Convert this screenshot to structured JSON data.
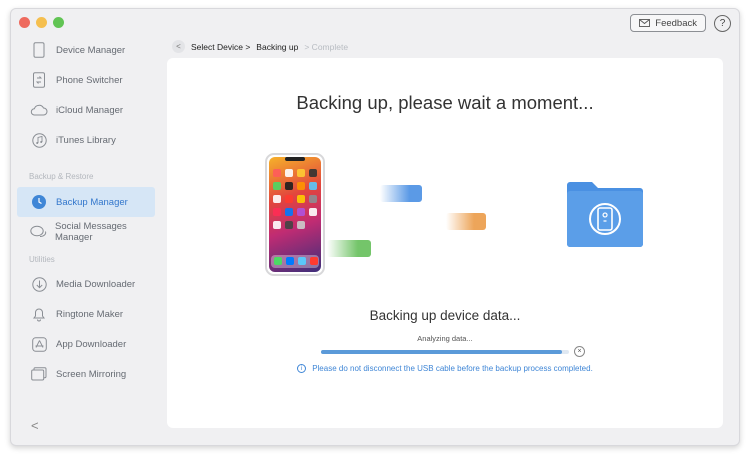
{
  "window": {
    "traffic_colors": [
      "#ee6a5e",
      "#f5bf4f",
      "#61c454"
    ]
  },
  "topbar": {
    "feedback_label": "Feedback",
    "help_label": "?"
  },
  "sidebar": {
    "items": [
      {
        "label": "Device Manager",
        "icon": "phone-outline-icon"
      },
      {
        "label": "Phone Switcher",
        "icon": "phone-transfer-icon"
      },
      {
        "label": "iCloud Manager",
        "icon": "cloud-icon"
      },
      {
        "label": "iTunes Library",
        "icon": "music-note-icon"
      },
      {
        "label": "Backup Manager",
        "icon": "backup-clock-icon",
        "active": true
      },
      {
        "label": "Social Messages Manager",
        "icon": "chat-bubbles-icon"
      },
      {
        "label": "Media Downloader",
        "icon": "download-circle-icon"
      },
      {
        "label": "Ringtone Maker",
        "icon": "bell-icon"
      },
      {
        "label": "App Downloader",
        "icon": "app-store-icon"
      },
      {
        "label": "Screen Mirroring",
        "icon": "screen-mirror-icon"
      }
    ],
    "sections": {
      "backup_restore": "Backup & Restore",
      "utilities": "Utilities"
    },
    "collapse_label": "<"
  },
  "breadcrumb": {
    "back": "<",
    "step1": "Select Device >",
    "step2": "Backing up",
    "step3": "> Complete"
  },
  "main": {
    "headline": "Backing up, please wait a moment...",
    "status_title": "Backing up device data...",
    "status_sub": "Analyzing data...",
    "progress_fraction": 0.97,
    "cancel_label": "×",
    "notice": "Please do not disconnect the USB cable before the backup process completed.",
    "notice_icon": "i"
  },
  "colors": {
    "accent": "#3f86d6",
    "active_bg": "#d6e6f6",
    "folder": "#4a90e2"
  }
}
